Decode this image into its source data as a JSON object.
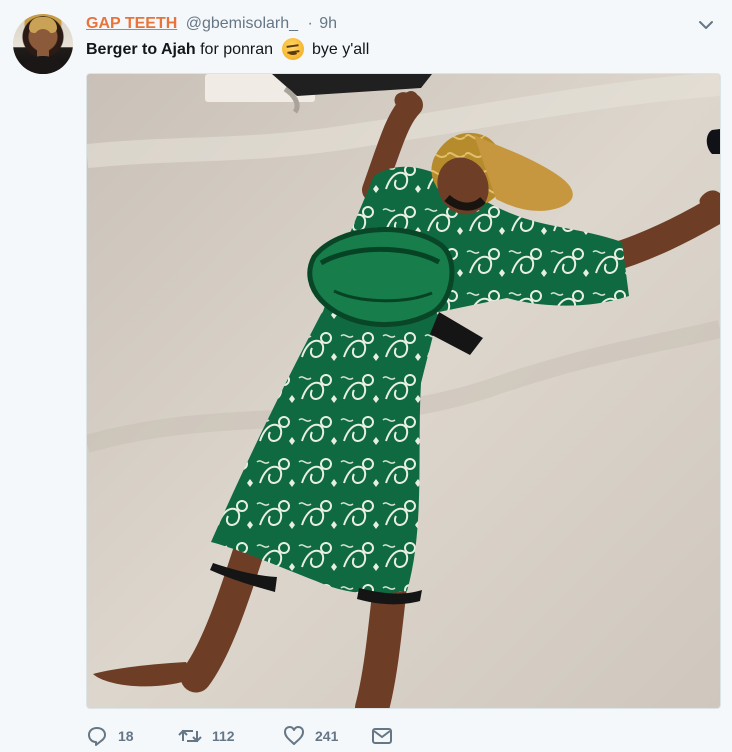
{
  "tweet": {
    "author": {
      "display_name": "GAP TEETH",
      "handle": "@gbemisolarh_",
      "separator": "·",
      "time": "9h"
    },
    "text": {
      "bold_part": "Berger to Ajah",
      "middle_part": "for ponran",
      "end_part": "bye y'all",
      "emoji": "tired-face-emoji"
    },
    "media": {
      "alt": "Photo of a man lying on a carpet in a green patterned outfit and gold head wrap"
    },
    "actions": {
      "reply_count": "18",
      "retweet_count": "112",
      "like_count": "241"
    },
    "icons": {
      "reply": "reply-icon",
      "retweet": "retweet-icon",
      "like": "heart-icon",
      "message": "envelope-icon",
      "menu": "chevron-down-icon"
    },
    "colors": {
      "display_name": "#e8743b",
      "muted_text": "#657786",
      "primary_text": "#14171a",
      "background": "#f5f8fa"
    }
  }
}
